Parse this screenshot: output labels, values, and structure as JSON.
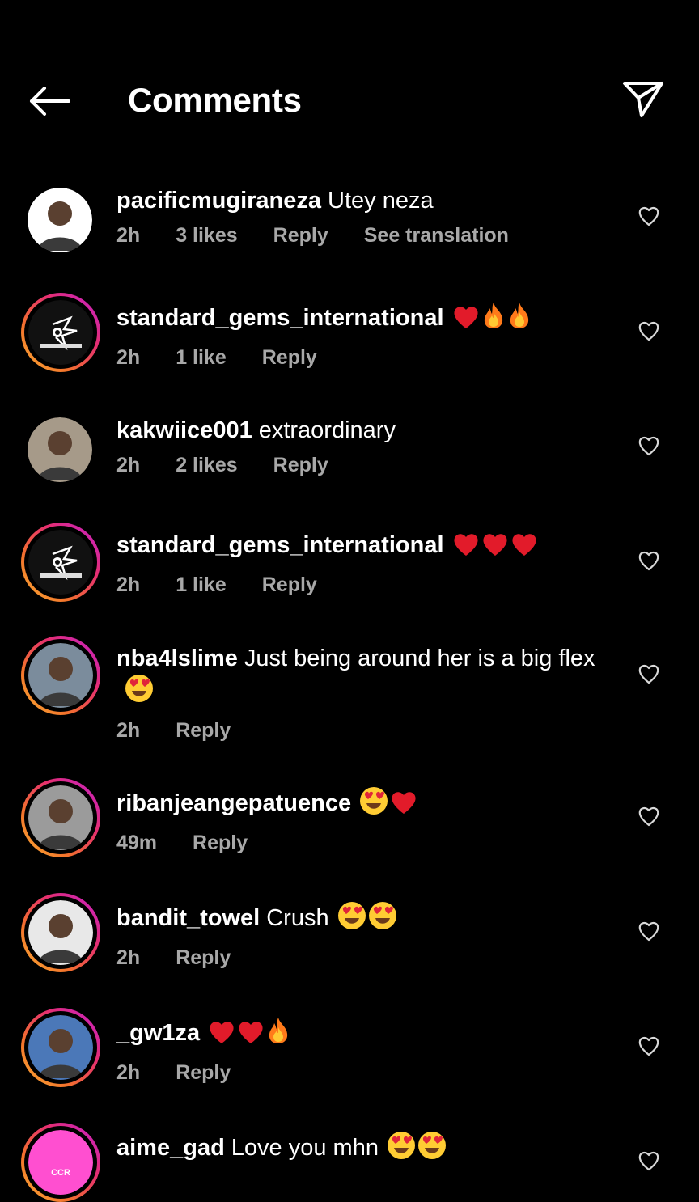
{
  "header": {
    "title": "Comments",
    "back_icon": "arrow-left-icon",
    "share_icon": "paper-plane-icon"
  },
  "comments": [
    {
      "username": "pacificmugiraneza",
      "text": "Utey neza",
      "emojis": [],
      "time": "2h",
      "likes": "3 likes",
      "reply": "Reply",
      "translation": "See translation",
      "ring": false,
      "avatar_color": "#ffffff"
    },
    {
      "username": "standard_gems_international",
      "text": "",
      "emojis": [
        "heart",
        "fire",
        "fire"
      ],
      "time": "2h",
      "likes": "1 like",
      "reply": "Reply",
      "translation": "",
      "ring": true,
      "avatar_color": "#111111"
    },
    {
      "username": "kakwiice001",
      "text": "extraordinary",
      "emojis": [],
      "time": "2h",
      "likes": "2 likes",
      "reply": "Reply",
      "translation": "",
      "ring": false,
      "avatar_color": "#a69a89"
    },
    {
      "username": "standard_gems_international",
      "text": "",
      "emojis": [
        "heart",
        "heart",
        "heart"
      ],
      "time": "2h",
      "likes": "1 like",
      "reply": "Reply",
      "translation": "",
      "ring": true,
      "avatar_color": "#111111"
    },
    {
      "username": "nba4lslime",
      "text": "Just being around her is a big flex",
      "emojis": [
        "heart-eyes"
      ],
      "time": "2h",
      "likes": "",
      "reply": "Reply",
      "translation": "",
      "ring": true,
      "avatar_color": "#7b8c9c"
    },
    {
      "username": "ribanjeangepatuence",
      "text": "",
      "emojis": [
        "heart-eyes",
        "heart"
      ],
      "time": "49m",
      "likes": "",
      "reply": "Reply",
      "translation": "",
      "ring": true,
      "avatar_color": "#9b9b9b"
    },
    {
      "username": "bandit_towel",
      "text": "Crush",
      "emojis": [
        "heart-eyes",
        "heart-eyes"
      ],
      "time": "2h",
      "likes": "",
      "reply": "Reply",
      "translation": "",
      "ring": true,
      "avatar_color": "#e8e8e8"
    },
    {
      "username": "_gw1za",
      "text": "",
      "emojis": [
        "heart",
        "heart",
        "fire"
      ],
      "time": "2h",
      "likes": "",
      "reply": "Reply",
      "translation": "",
      "ring": true,
      "avatar_color": "#4b78b8"
    },
    {
      "username": "aime_gad",
      "text": "Love you mhn",
      "emojis": [
        "heart-eyes",
        "heart-eyes"
      ],
      "time": "",
      "likes": "",
      "reply": "",
      "translation": "",
      "ring": true,
      "avatar_color": "#ff4fd0",
      "avatar_label": "CCR"
    }
  ]
}
